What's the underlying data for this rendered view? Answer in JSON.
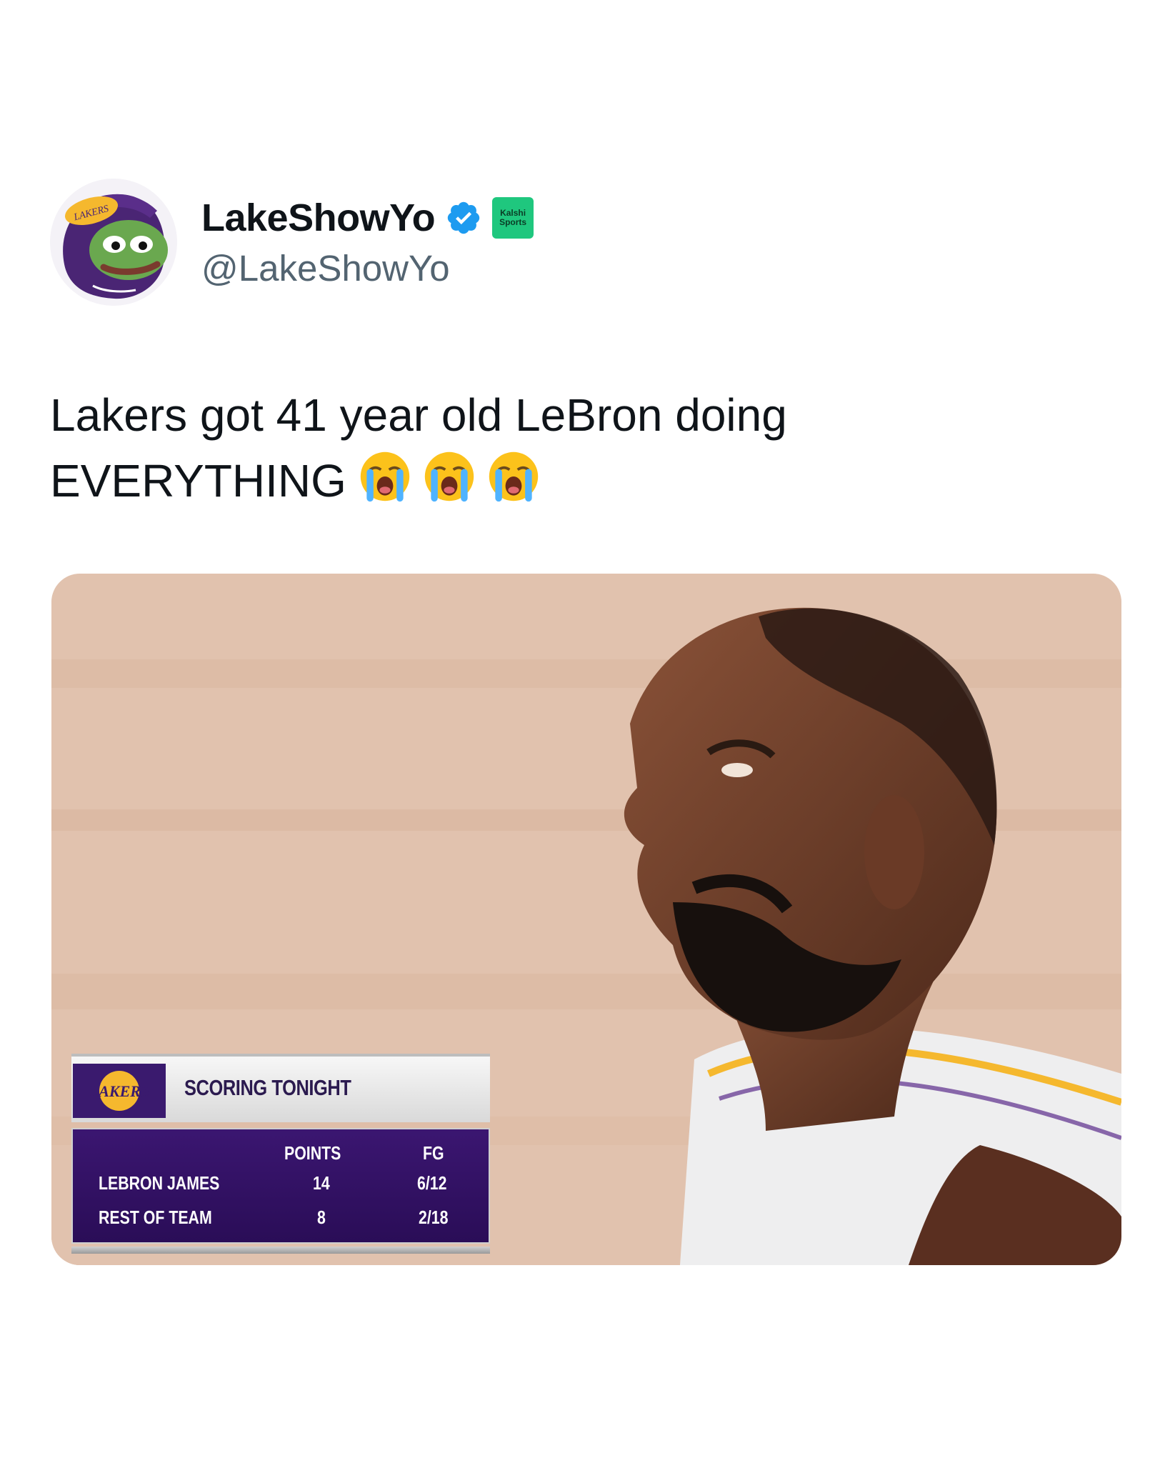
{
  "tweet": {
    "display_name": "LakeShowYo",
    "handle": "@LakeShowYo",
    "affiliate_badge": [
      "Kalshi",
      "Sports"
    ],
    "text_line1": "Lakers got 41 year old LeBron doing",
    "text_line2": "EVERYTHING",
    "emojis": [
      "loudly-crying-face",
      "loudly-crying-face",
      "loudly-crying-face"
    ]
  },
  "media": {
    "scoreboard": {
      "title": "SCORING TONIGHT",
      "columns": [
        "POINTS",
        "FG"
      ],
      "rows": [
        {
          "name": "LEBRON JAMES",
          "points": "14",
          "fg": "6/12"
        },
        {
          "name": "REST OF TEAM",
          "points": "8",
          "fg": "2/18"
        }
      ]
    }
  },
  "colors": {
    "verified": "#1d9bf0",
    "handle": "#536471",
    "lakers_purple": "#3a1a6e",
    "lakers_gold": "#f5b82e",
    "kalshi_green": "#1fc77e"
  }
}
